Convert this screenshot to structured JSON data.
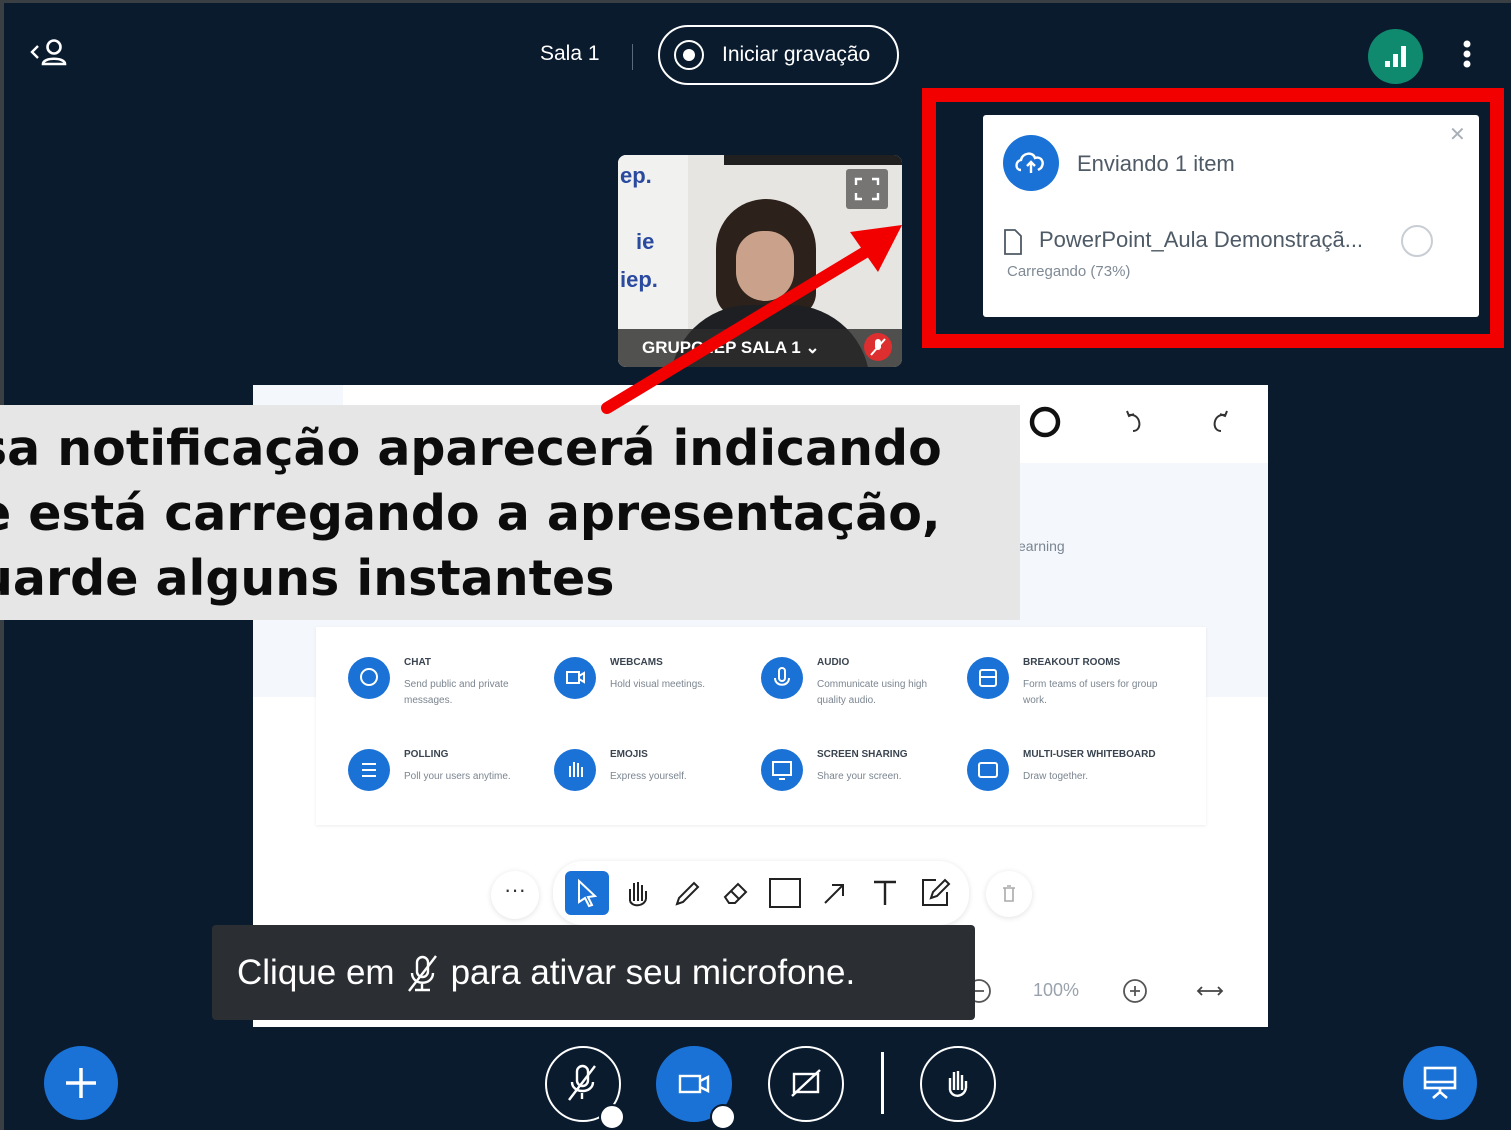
{
  "topbar": {
    "room_name": "Sala 1",
    "record_label": "Iniciar gravação",
    "users_toggle_icon": "users-icon",
    "connection_icon": "signal-bars-icon",
    "more_icon": "kebab-icon"
  },
  "upload_toast": {
    "title": "Enviando 1 item",
    "file_name": "PowerPoint_Aula Demonstraçã...",
    "status": "Carregando (73%)",
    "progress_percent": 73,
    "icon": "cloud-upload-icon",
    "close_icon": "close-icon"
  },
  "webcam": {
    "user_label": "GRUPO IEP SALA 1 ⌄",
    "logo_marks": [
      "ep.",
      "ie",
      "iep."
    ]
  },
  "presentation": {
    "slide_text": "earning",
    "features": [
      {
        "title": "CHAT",
        "desc": "Send public and private messages.",
        "icon": "chat-icon"
      },
      {
        "title": "WEBCAMS",
        "desc": "Hold visual meetings.",
        "icon": "video-icon"
      },
      {
        "title": "AUDIO",
        "desc": "Communicate using high quality audio.",
        "icon": "mic-icon"
      },
      {
        "title": "BREAKOUT ROOMS",
        "desc": "Form teams of users for group work.",
        "icon": "rooms-icon"
      },
      {
        "title": "POLLING",
        "desc": "Poll your users anytime.",
        "icon": "list-icon"
      },
      {
        "title": "EMOJIS",
        "desc": "Express yourself.",
        "icon": "hand-icon"
      },
      {
        "title": "SCREEN SHARING",
        "desc": "Share your screen.",
        "icon": "monitor-icon"
      },
      {
        "title": "MULTI-USER WHITEBOARD",
        "desc": "Draw together.",
        "icon": "whiteboard-icon"
      }
    ],
    "zoom": "100%",
    "toolbar_more": "···"
  },
  "annotation": {
    "text": "sa notificação aparecerá indicando\ne está carregando a apresentação,\nuarde alguns instantes"
  },
  "tooltip": {
    "before": "Clique em",
    "after": "para ativar seu microfone."
  },
  "colors": {
    "background": "#0a1b2e",
    "accent": "#1a72d6",
    "highlight": "#f20000",
    "connection": "#0f8a6e"
  }
}
